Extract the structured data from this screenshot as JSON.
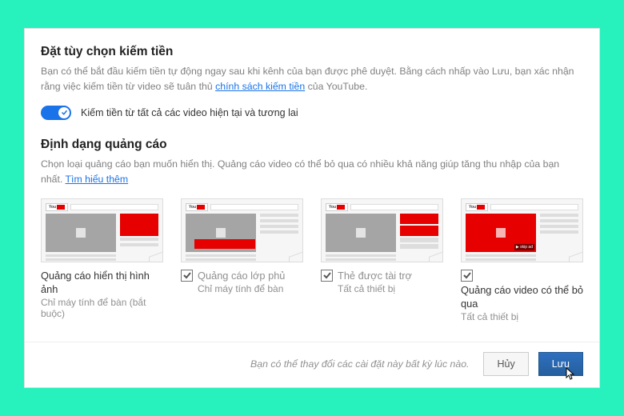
{
  "monetization": {
    "title": "Đặt tùy chọn kiếm tiền",
    "desc_pre": "Bạn có thể bắt đầu kiếm tiền tự động ngay sau khi kênh của bạn được phê duyệt. Bằng cách nhấp vào Lưu, bạn xác nhận rằng việc kiếm tiền từ video sẽ tuân thủ ",
    "desc_link": "chính sách kiếm tiền",
    "desc_post": " của YouTube.",
    "toggle_label": "Kiếm tiền từ tất cả các video hiện tại và tương lai",
    "toggle_on": true
  },
  "ad_formats": {
    "title": "Định dạng quảng cáo",
    "desc_pre": "Chọn loại quảng cáo bạn muốn hiển thị. Quảng cáo video có thể bỏ qua có nhiều khả năng giúp tăng thu nhập của bạn nhất. ",
    "learn_more": "Tìm hiểu thêm",
    "items": [
      {
        "name": "Quảng cáo hiển thị hình ảnh",
        "sub": "Chỉ máy tính để bàn (bắt buộc)",
        "checkbox": false,
        "checked": false
      },
      {
        "name": "Quảng cáo lớp phủ",
        "sub": "Chỉ máy tính để bàn",
        "checkbox": true,
        "checked": true
      },
      {
        "name": "Thẻ được tài trợ",
        "sub": "Tất cả thiết bị",
        "checkbox": true,
        "checked": true
      },
      {
        "name": "Quảng cáo video có thể bỏ qua",
        "sub": "Tất cả thiết bị",
        "checkbox": true,
        "checked": true
      }
    ]
  },
  "footer": {
    "note": "Bạn có thể thay đổi các cài đặt này bất kỳ lúc nào.",
    "cancel": "Hủy",
    "save": "Lưu"
  },
  "thumb_text": {
    "youtube": "You",
    "skip": "▶ skip ad"
  }
}
